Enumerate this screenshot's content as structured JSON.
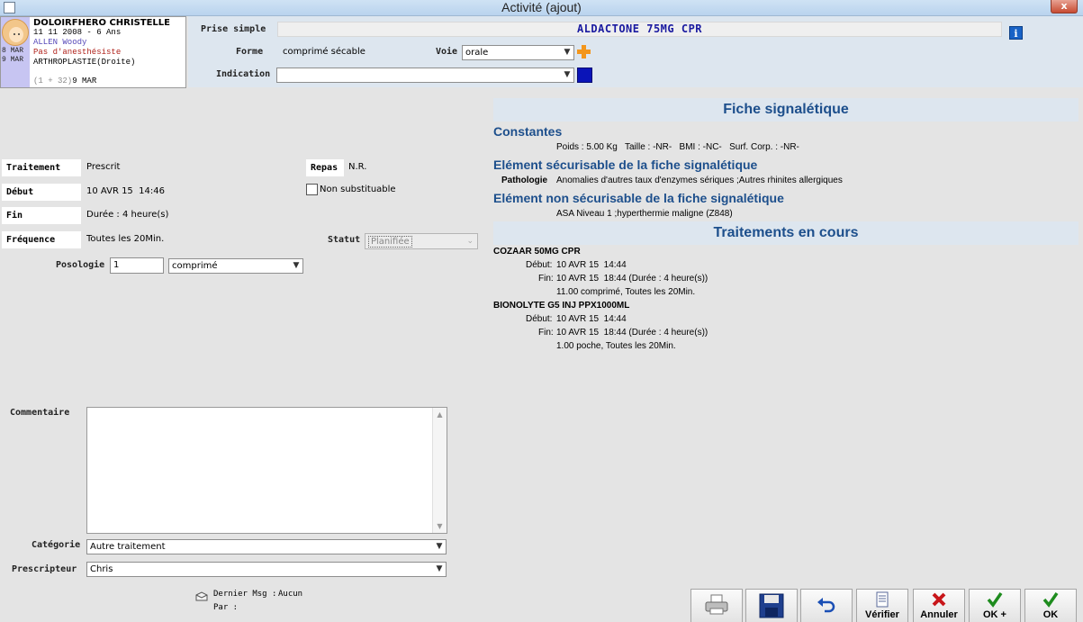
{
  "window": {
    "title": "Activité (ajout)",
    "close_glyph": "x"
  },
  "patient": {
    "name": "DOLOIRFHERO CHRISTELLE",
    "dob_age": "11 11 2008 - 6 Ans",
    "doctor": "ALLEN Woody",
    "anesthesia": "Pas d'anesthésiste",
    "procedure": "ARTHROPLASTIE(Droite)",
    "date1": "8 MAR",
    "date2": "9 MAR",
    "footer_days": "(1 + 32)",
    "footer_date": "9 MAR"
  },
  "header": {
    "prise_simple_label": "Prise simple",
    "drug_name": "ALDACTONE 75MG CPR",
    "forme_label": "Forme",
    "forme_value": "comprimé sécable",
    "voie_label": "Voie",
    "voie_value": "orale",
    "indication_label": "Indication",
    "indication_value": "",
    "info_glyph": "i"
  },
  "form": {
    "traitement_label": "Traitement",
    "traitement_value": "Prescrit",
    "debut_label": "Début",
    "debut_value": "10 AVR 15  14:46",
    "fin_label": "Fin",
    "fin_value": "Durée : 4 heure(s)",
    "frequence_label": "Fréquence",
    "frequence_value": "Toutes les 20Min.",
    "repas_label": "Repas",
    "repas_value": "N.R.",
    "non_substituable_label": "Non substituable",
    "statut_label": "Statut",
    "statut_value": "Planifiée",
    "posologie_label": "Posologie",
    "posologie_qty": "1",
    "posologie_unit": "comprimé",
    "commentaire_label": "Commentaire",
    "categorie_label": "Catégorie",
    "categorie_value": "Autre traitement",
    "prescripteur_label": "Prescripteur",
    "prescripteur_value": "Chris",
    "dernier_msg_label": "Dernier Msg :",
    "dernier_msg_value": "Aucun",
    "par_label": "Par :"
  },
  "fiche": {
    "title": "Fiche signalétique",
    "constantes_title": "Constantes",
    "constantes_text": "Poids : 5.00 Kg   Taille : -NR-   BMI : -NC-   Surf. Corp. : -NR-",
    "securisable_title": "Elément sécurisable de la fiche signalétique",
    "pathologie_label": "Pathologie",
    "pathologie_text": "Anomalies d'autres taux d'enzymes sériques ;Autres rhinites allergiques",
    "non_securisable_title": "Elément non sécurisable de la fiche signalétique",
    "non_securisable_text": "ASA Niveau 1 ;hyperthermie maligne (Z848)"
  },
  "traitements": {
    "title": "Traitements en cours",
    "items": [
      {
        "name": "COZAAR 50MG CPR",
        "debut_label": "Début:",
        "debut": "10 AVR 15  14:44",
        "fin_label": "Fin:",
        "fin": "10 AVR 15  18:44 (Durée : 4 heure(s))",
        "dose": "11.00 comprimé, Toutes les 20Min."
      },
      {
        "name": "BIONOLYTE G5 INJ PPX1000ML",
        "debut_label": "Début:",
        "debut": "10 AVR 15  14:44",
        "fin_label": "Fin:",
        "fin": "10 AVR 15  18:44 (Durée : 4 heure(s))",
        "dose": "1.00 poche, Toutes les 20Min."
      }
    ]
  },
  "buttons": {
    "print_label": "",
    "save_label": "",
    "undo_label": "",
    "verifier_label": "Vérifier",
    "annuler_label": "Annuler",
    "ok_plus_label": "OK +",
    "ok_label": "OK"
  },
  "colors": {
    "accent_blue": "#1d4f8c",
    "drug_blue": "#1a1aa0",
    "plus_orange": "#f3961c",
    "cancel_red": "#c8161a",
    "ok_green": "#1e8c1e"
  }
}
